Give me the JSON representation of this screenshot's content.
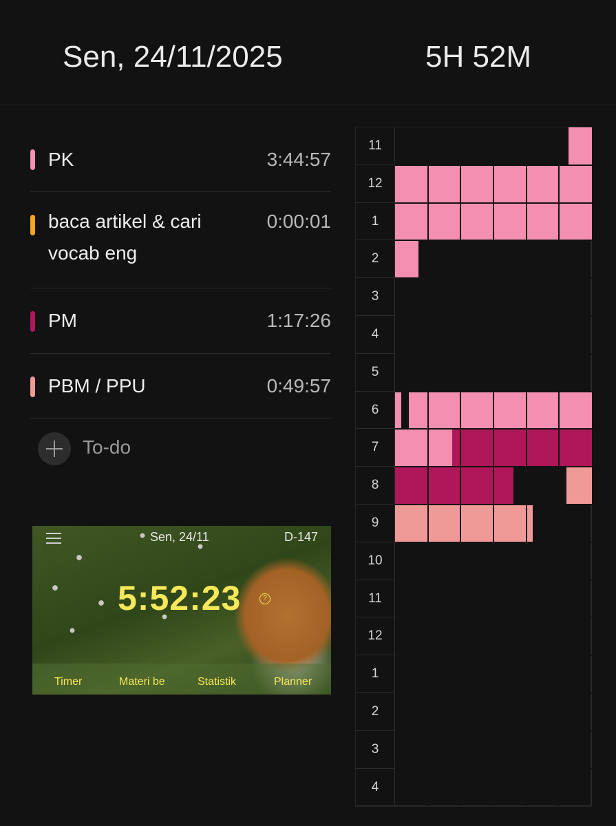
{
  "header": {
    "date": "Sen, 24/11/2025",
    "total": "5H 52M"
  },
  "tasks": [
    {
      "lines": [
        "PK"
      ],
      "time": "3:44:57",
      "color": "#f48fb1"
    },
    {
      "lines": [
        "baca artikel & cari",
        "vocab eng"
      ],
      "time": "0:00:01",
      "color": "#f5a623"
    },
    {
      "lines": [
        "PM"
      ],
      "time": "1:17:26",
      "color": "#b0175a"
    },
    {
      "lines": [
        "PBM / PPU"
      ],
      "time": "0:49:57",
      "color": "#f09a98"
    }
  ],
  "todo": {
    "label": "To-do",
    "icon": "plus-icon"
  },
  "thumbnail": {
    "date": "Sen, 24/11",
    "dday": "D-147",
    "clock": "5:52:23",
    "help_icon": "?",
    "nav": [
      "Timer",
      "Materi be",
      "Statistik",
      "Planner"
    ]
  },
  "timeline": {
    "hours": [
      "11",
      "12",
      "1",
      "2",
      "3",
      "4",
      "5",
      "6",
      "7",
      "8",
      "9",
      "10",
      "11",
      "12",
      "1",
      "2",
      "3",
      "4"
    ],
    "columns": 6,
    "blocks": [
      {
        "task": "PK",
        "row": 0,
        "start": 0.88,
        "end": 1.0
      },
      {
        "task": "PK",
        "row": 1,
        "start": 0.0,
        "end": 1.0
      },
      {
        "task": "PK",
        "row": 2,
        "start": 0.0,
        "end": 1.0
      },
      {
        "task": "PK",
        "row": 3,
        "start": 0.0,
        "end": 0.12
      },
      {
        "task": "PK",
        "row": 7,
        "start": 0.0,
        "end": 0.03
      },
      {
        "task": "PK",
        "row": 7,
        "start": 0.07,
        "end": 1.0
      },
      {
        "task": "PK",
        "row": 8,
        "start": 0.0,
        "end": 0.29
      },
      {
        "task": "PM",
        "row": 8,
        "start": 0.29,
        "end": 1.0
      },
      {
        "task": "PM",
        "row": 9,
        "start": 0.0,
        "end": 0.6
      },
      {
        "task": "PBM / PPU",
        "row": 9,
        "start": 0.87,
        "end": 1.0
      },
      {
        "task": "PBM / PPU",
        "row": 10,
        "start": 0.0,
        "end": 0.7
      }
    ]
  }
}
